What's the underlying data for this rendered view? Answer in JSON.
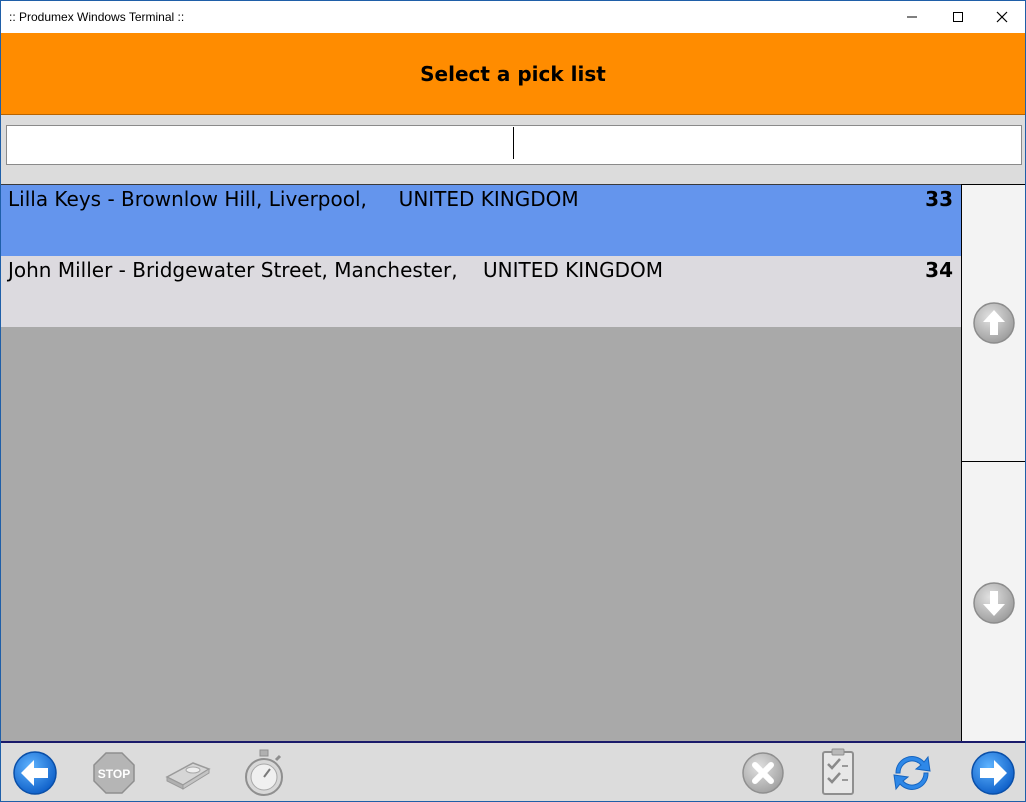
{
  "window": {
    "title": ":: Produmex Windows Terminal ::"
  },
  "header": {
    "title": "Select a pick list"
  },
  "search": {
    "value": "",
    "placeholder": ""
  },
  "pick_lists": [
    {
      "label": "Lilla Keys - Brownlow Hill, Liverpool,     UNITED KINGDOM",
      "number": "33",
      "selected": true
    },
    {
      "label": "John Miller - Bridgewater Street, Manchester,    UNITED KINGDOM",
      "number": "34",
      "selected": false
    }
  ],
  "footer": {
    "stop_label": "STOP",
    "icons": [
      "back-arrow-icon",
      "stop-sign-icon",
      "scanner-icon",
      "stopwatch-icon",
      "cancel-icon",
      "checklist-icon",
      "refresh-icon",
      "forward-arrow-icon"
    ]
  },
  "colors": {
    "header": "#ff8c00",
    "selected_row": "#6495ed",
    "row": "#dcdadf",
    "list_background": "#a9a9a9",
    "nav_blue": "#1e78e6"
  }
}
